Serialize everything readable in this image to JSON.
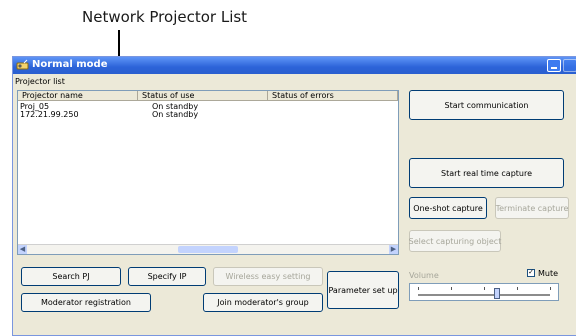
{
  "callouts": {
    "top_label": "Network Projector List"
  },
  "window": {
    "title": "Normal mode",
    "list_caption": "Projector list"
  },
  "projector_list": {
    "columns": [
      "Projector name",
      "Status of use",
      "Status of errors"
    ],
    "rows": [
      {
        "name": "Proj_05",
        "status_use": "On standby",
        "status_errors": ""
      },
      {
        "name": "172.21.99.250",
        "status_use": "On standby",
        "status_errors": ""
      }
    ]
  },
  "buttons": {
    "search_pj": "Search PJ",
    "specify_ip": "Specify IP",
    "wireless_easy_setting": "Wireless easy setting",
    "moderator_registration": "Moderator registration",
    "join_moderators_group": "Join moderator's group",
    "parameter_set_up": "Parameter set up",
    "start_communication": "Start communication",
    "start_real_time_capture": "Start real time capture",
    "one_shot_capture": "One-shot capture",
    "terminate_capture": "Terminate capture",
    "select_capturing_object": "Select capturing object"
  },
  "volume": {
    "label": "Volume",
    "mute_label": "Mute",
    "mute_checked": true,
    "level": 0.6
  }
}
